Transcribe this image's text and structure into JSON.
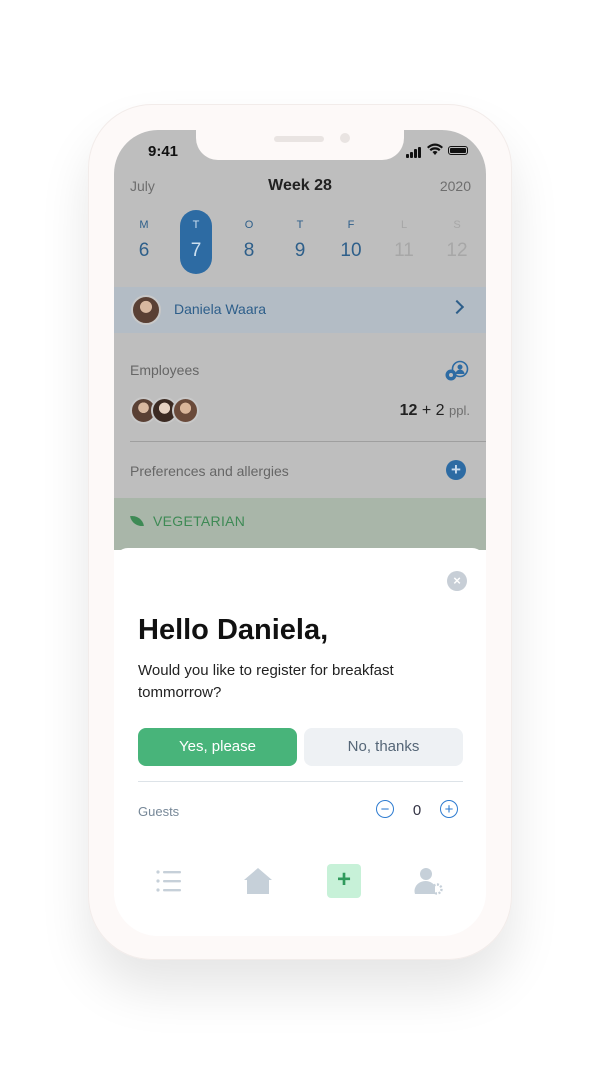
{
  "status": {
    "time": "9:41"
  },
  "calendar": {
    "month": "July",
    "week": "Week 28",
    "year": "2020",
    "days": [
      {
        "letter": "M",
        "number": "6"
      },
      {
        "letter": "T",
        "number": "7"
      },
      {
        "letter": "O",
        "number": "8"
      },
      {
        "letter": "T",
        "number": "9"
      },
      {
        "letter": "F",
        "number": "10"
      },
      {
        "letter": "L",
        "number": "11"
      },
      {
        "letter": "S",
        "number": "12"
      }
    ]
  },
  "user": {
    "name": "Daniela Waara"
  },
  "employees": {
    "label": "Employees",
    "count": "12",
    "extra": "+ 2",
    "unit": "ppl."
  },
  "preferences": {
    "label": "Preferences and allergies",
    "tag": "VEGETARIAN"
  },
  "sheet": {
    "close_icon": "×",
    "title": "Hello Daniela,",
    "question": "Would you like to register for breakfast tommorrow?",
    "yes_label": "Yes, please",
    "no_label": "No, thanks",
    "guests_label": "Guests",
    "guests_value": "0",
    "minus_symbol": "−",
    "plus_symbol": "+"
  },
  "tabbar": {
    "icons": [
      "list-icon",
      "home-icon",
      "add-icon",
      "user-settings-icon"
    ],
    "add_symbol": "+"
  },
  "colors": {
    "accent_blue": "#2d6ba3",
    "green": "#48b47a",
    "veg_green": "#3e8a55"
  }
}
